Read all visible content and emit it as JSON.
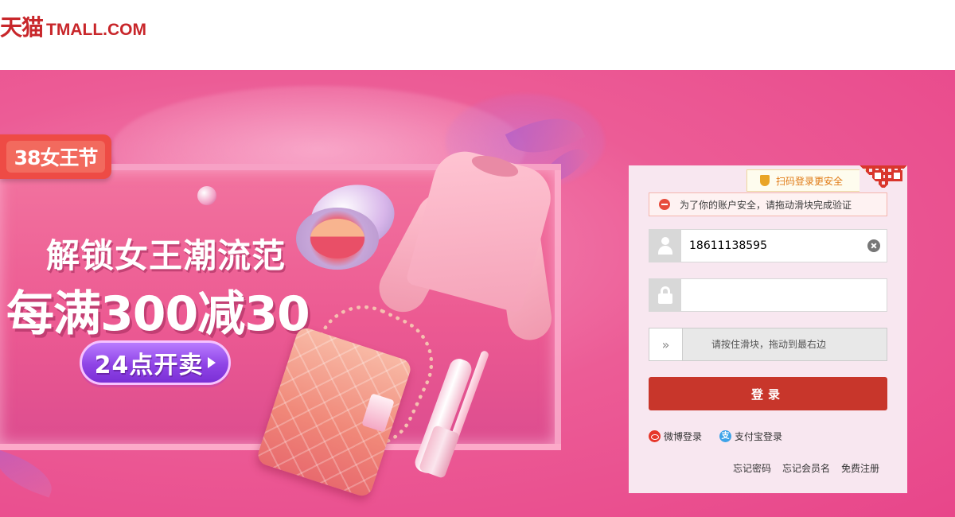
{
  "header": {
    "logo_cn": "天猫",
    "logo_en": "TMALL.COM"
  },
  "banner": {
    "tag": "38女王节",
    "headline1": "解锁女王潮流范",
    "headline2": "每满300减30",
    "sale_button": "24点开卖"
  },
  "login": {
    "qr_tip": "扫码登录更安全",
    "error_message": "为了你的账户安全，请拖动滑块完成验证",
    "username_value": "18611138595",
    "password_value": "",
    "slider_handle": "»",
    "slider_text": "请按住滑块，拖动到最右边",
    "submit_label": "登录",
    "alt_logins": [
      "微博登录",
      "支付宝登录"
    ],
    "alipay_glyph": "支",
    "links": [
      "忘记密码",
      "忘记会员名",
      "免费注册"
    ]
  },
  "colors": {
    "brand_red": "#c8262a",
    "button_red": "#c8362b",
    "banner_pink": "#e8468a",
    "panel_bg": "#f8e7f0"
  }
}
